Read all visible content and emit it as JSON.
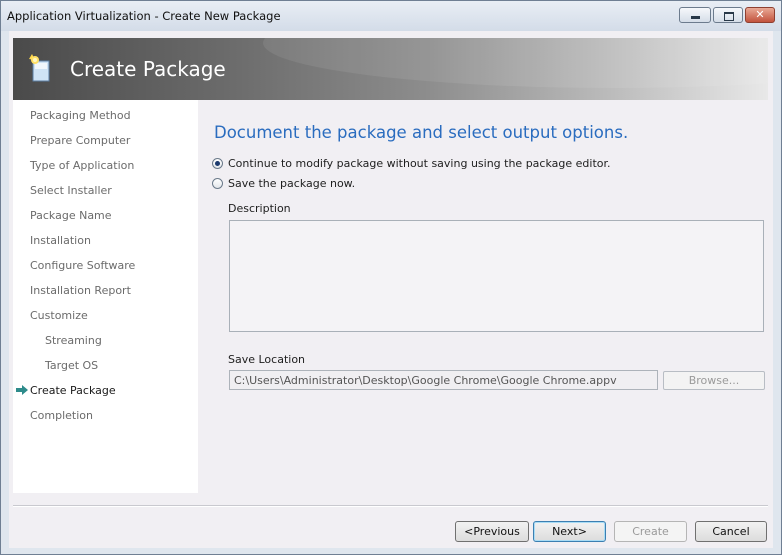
{
  "window": {
    "title": "Application Virtualization - Create New Package",
    "close_glyph": "✕"
  },
  "banner": {
    "title": "Create Package",
    "icon": "package-wizard-icon"
  },
  "sidebar": {
    "items": [
      {
        "label": "Packaging Method",
        "sub": false,
        "active": false
      },
      {
        "label": "Prepare Computer",
        "sub": false,
        "active": false
      },
      {
        "label": "Type of Application",
        "sub": false,
        "active": false
      },
      {
        "label": "Select Installer",
        "sub": false,
        "active": false
      },
      {
        "label": "Package Name",
        "sub": false,
        "active": false
      },
      {
        "label": "Installation",
        "sub": false,
        "active": false
      },
      {
        "label": "Configure Software",
        "sub": false,
        "active": false
      },
      {
        "label": "Installation Report",
        "sub": false,
        "active": false
      },
      {
        "label": "Customize",
        "sub": false,
        "active": false
      },
      {
        "label": "Streaming",
        "sub": true,
        "active": false
      },
      {
        "label": "Target OS",
        "sub": true,
        "active": false
      },
      {
        "label": "Create Package",
        "sub": false,
        "active": true
      },
      {
        "label": "Completion",
        "sub": false,
        "active": false
      }
    ]
  },
  "main": {
    "heading": "Document the package and select output options.",
    "option_modify": "Continue to modify package without saving using the package editor.",
    "option_save": "Save the package now.",
    "selected_option": "modify",
    "description_label": "Description",
    "description_value": "",
    "save_location_label": "Save Location",
    "save_location_value": "C:\\Users\\Administrator\\Desktop\\Google Chrome\\Google Chrome.appv",
    "browse_label": "Browse..."
  },
  "footer": {
    "previous_label": "<Previous",
    "next_label": "Next>",
    "create_label": "Create",
    "cancel_label": "Cancel"
  },
  "colors": {
    "heading": "#2a6cbf",
    "active_arrow": "#2e8b8b"
  }
}
